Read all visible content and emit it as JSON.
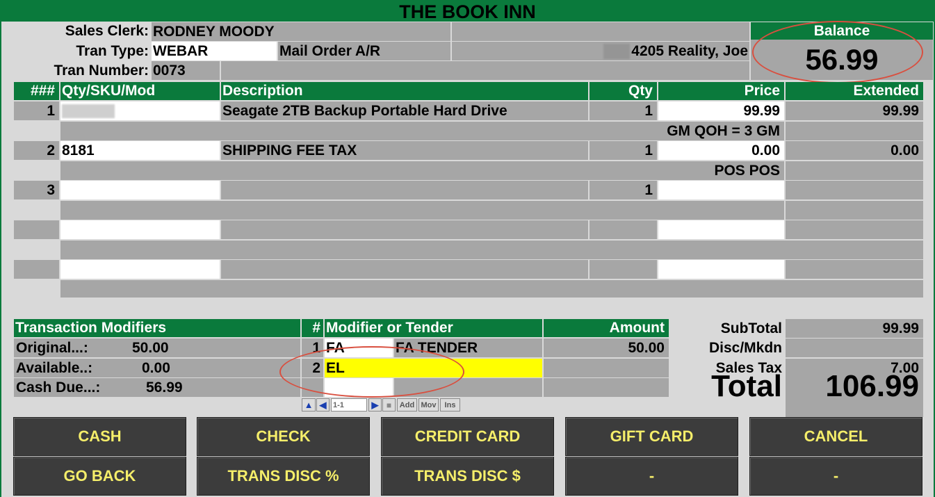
{
  "app": {
    "title": "THE BOOK INN"
  },
  "header": {
    "clerk_label": "Sales Clerk:",
    "clerk_value": "RODNEY MOODY",
    "tran_type_label": "Tran Type:",
    "tran_type_value": "WEBAR",
    "tran_type_desc": "Mail Order A/R",
    "customer": "4205 Reality, Joe",
    "tran_number_label": "Tran Number:",
    "tran_number_value": "0073"
  },
  "balance": {
    "label": "Balance",
    "value": "56.99"
  },
  "lines": {
    "headers": {
      "num": "###",
      "sku": "Qty/SKU/Mod",
      "desc": "Description",
      "qty": "Qty",
      "price": "Price",
      "ext": "Extended"
    },
    "rows": [
      {
        "num": "1",
        "sku": "",
        "desc": "Seagate 2TB Backup Portable Hard Drive",
        "qty": "1",
        "price": "99.99",
        "ext": "99.99",
        "sub": "GM QOH = 3 GM"
      },
      {
        "num": "2",
        "sku": "8181",
        "desc": "SHIPPING FEE TAX",
        "qty": "1",
        "price": "0.00",
        "ext": "0.00",
        "sub": "POS POS"
      },
      {
        "num": "3",
        "sku": "",
        "desc": "",
        "qty": "1",
        "price": "",
        "ext": "",
        "sub": ""
      }
    ]
  },
  "modifiers": {
    "title": "Transaction Modifiers",
    "original_label": "Original...:",
    "original_value": "50.00",
    "available_label": "Available..:",
    "available_value": "0.00",
    "cashdue_label": "Cash Due...:",
    "cashdue_value": "56.99"
  },
  "tender": {
    "headers": {
      "num": "#",
      "mod": "Modifier or Tender",
      "amount": "Amount"
    },
    "rows": [
      {
        "num": "1",
        "code": "FA",
        "desc": "FA TENDER",
        "amount": "50.00"
      },
      {
        "num": "2",
        "code": "EL",
        "desc": "",
        "amount": ""
      }
    ]
  },
  "navigator": {
    "record": "1-1",
    "add": "Add",
    "mov": "Mov",
    "ins": "Ins"
  },
  "totals": {
    "subtotal_label": "SubTotal",
    "subtotal_value": "99.99",
    "disc_label": "Disc/Mkdn",
    "disc_value": "",
    "tax_label": "Sales Tax",
    "tax_value": "7.00",
    "total_label": "Total",
    "total_value": "106.99"
  },
  "buttons": {
    "cash": "CASH",
    "check": "CHECK",
    "credit": "CREDIT CARD",
    "gift": "GIFT CARD",
    "cancel": "CANCEL",
    "goback": "GO BACK",
    "disc_pct": "TRANS DISC %",
    "disc_amt": "TRANS DISC $",
    "blank1": "-",
    "blank2": "-"
  },
  "colors": {
    "header_green": "#0a7a3c",
    "button_text": "#f5ee6a",
    "highlight": "#ffff00",
    "annotation": "#d94f3f"
  }
}
